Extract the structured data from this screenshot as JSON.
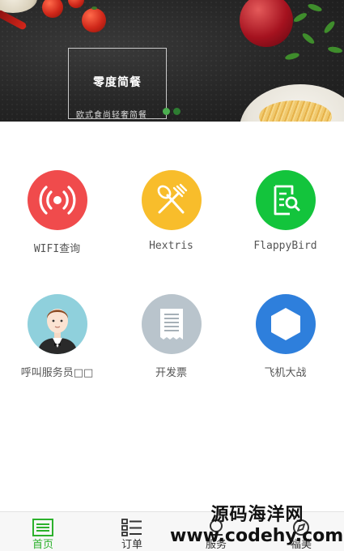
{
  "banner": {
    "title": "零度简餐",
    "subtitle": "欧式食尚轻奢简餐",
    "carousel": {
      "count": 2,
      "active_index": 1,
      "active_color": "#2e7d32",
      "inactive_color": "#4caf50"
    }
  },
  "grid": [
    {
      "label": "WIFI查询",
      "icon": "wifi-signal-icon",
      "color": "#f04b4c"
    },
    {
      "label": "Hextris",
      "icon": "spoon-fork-icon",
      "color": "#f8bd2b"
    },
    {
      "label": "FlappyBird",
      "icon": "document-search-icon",
      "color": "#13c43c"
    },
    {
      "label": "呼叫服务员□□",
      "icon": "waiter-avatar-icon",
      "color": "#8fd0dc"
    },
    {
      "label": "开发票",
      "icon": "receipt-icon",
      "color": "#b9c4cc"
    },
    {
      "label": "飞机大战",
      "icon": "hexagon-icon",
      "color": "#2e7fdc"
    }
  ],
  "tabbar": {
    "items": [
      {
        "label": "首页",
        "icon": "home-list-icon",
        "active": true
      },
      {
        "label": "订单",
        "icon": "order-list-icon",
        "active": false
      },
      {
        "label": "服务",
        "icon": "service-icon",
        "active": false
      },
      {
        "label": "福美",
        "icon": "discover-icon",
        "active": false
      }
    ],
    "active_color": "#2cb12c",
    "inactive_color": "#333333"
  },
  "watermark": {
    "line1": "源码海洋网",
    "line2": "www.codehy.com"
  }
}
